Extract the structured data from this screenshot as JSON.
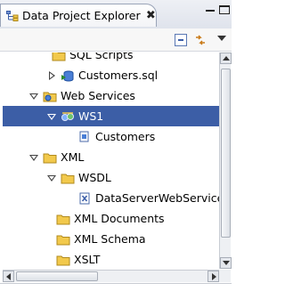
{
  "view": {
    "title": "Data Project Explorer",
    "close_glyph": "✖"
  },
  "colors": {
    "selection": "#3c5ea6",
    "folder": "#f2c94c",
    "tab_border": "#9aa4b8"
  },
  "tree": {
    "rows": [
      {
        "label": "SQL Scripts",
        "icon": "folder-icon",
        "twisty": "none"
      },
      {
        "label": "Customers.sql",
        "icon": "sql-file-icon",
        "twisty": "closed"
      },
      {
        "label": "Web Services",
        "icon": "folder-icon",
        "twisty": "open"
      },
      {
        "label": "WS1",
        "icon": "web-service-icon",
        "twisty": "open",
        "selected": true
      },
      {
        "label": "Customers",
        "icon": "operation-icon",
        "twisty": "none"
      },
      {
        "label": "XML",
        "icon": "folder-icon",
        "twisty": "open"
      },
      {
        "label": "WSDL",
        "icon": "folder-icon",
        "twisty": "open"
      },
      {
        "label": "DataServerWebService",
        "icon": "wsdl-file-icon",
        "twisty": "none"
      },
      {
        "label": "XML Documents",
        "icon": "folder-icon",
        "twisty": "none"
      },
      {
        "label": "XML Schema",
        "icon": "folder-icon",
        "twisty": "none"
      },
      {
        "label": "XSLT",
        "icon": "folder-icon",
        "twisty": "none"
      }
    ]
  }
}
